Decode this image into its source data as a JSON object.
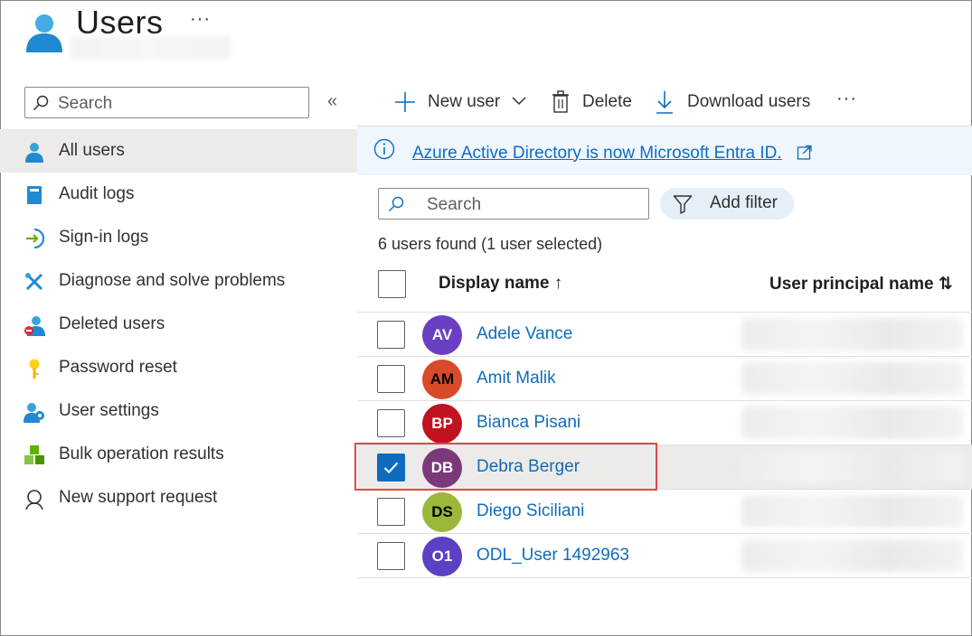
{
  "header": {
    "title": "Users",
    "more": "···"
  },
  "nav": {
    "search_placeholder": "Search",
    "collapse": "«",
    "items": [
      {
        "label": "All users",
        "icon": "user-icon",
        "active": true
      },
      {
        "label": "Audit logs",
        "icon": "book-icon"
      },
      {
        "label": "Sign-in logs",
        "icon": "sign-in-icon"
      },
      {
        "label": "Diagnose and solve problems",
        "icon": "wrench-icon"
      },
      {
        "label": "Deleted users",
        "icon": "deleted-user-icon"
      },
      {
        "label": "Password reset",
        "icon": "key-icon"
      },
      {
        "label": "User settings",
        "icon": "user-settings-icon"
      },
      {
        "label": "Bulk operation results",
        "icon": "cubes-icon"
      },
      {
        "label": "New support request",
        "icon": "support-icon"
      }
    ]
  },
  "toolbar": {
    "new_user": "New user",
    "delete": "Delete",
    "download": "Download users",
    "more": "···"
  },
  "banner": {
    "text": "Azure Active Directory is now Microsoft Entra ID."
  },
  "list": {
    "search_placeholder": "Search",
    "filter_label": "Add filter",
    "count_text": "6 users found (1 user selected)",
    "columns": {
      "display_name": "Display name ↑",
      "upn": "User principal name ⇅"
    },
    "rows": [
      {
        "initials": "AV",
        "name": "Adele Vance",
        "color": "#6b3fc4",
        "selected": false
      },
      {
        "initials": "AM",
        "name": "Amit Malik",
        "color": "#d84a2a",
        "selected": false,
        "text_color": "#000000"
      },
      {
        "initials": "BP",
        "name": "Bianca Pisani",
        "color": "#c1121f",
        "selected": false
      },
      {
        "initials": "DB",
        "name": "Debra Berger",
        "color": "#7a3a7a",
        "selected": true
      },
      {
        "initials": "DS",
        "name": "Diego Siciliani",
        "color": "#9bb83a",
        "selected": false,
        "text_color": "#000000"
      },
      {
        "initials": "O1",
        "name": "ODL_User 1492963",
        "color": "#5b3fc4",
        "selected": false
      }
    ]
  },
  "colors": {
    "accent": "#0f6cbd",
    "highlight": "#e0484a"
  }
}
